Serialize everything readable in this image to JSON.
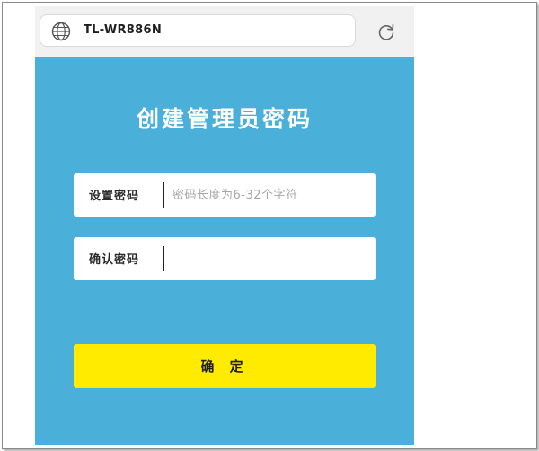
{
  "browser": {
    "url": "TL-WR886N",
    "icons": {
      "site": "globe-icon",
      "reload": "refresh-icon"
    }
  },
  "page": {
    "title": "创建管理员密码",
    "background_color": "#4aafd9"
  },
  "form": {
    "set_password": {
      "label": "设置密码",
      "value": "",
      "placeholder": "密码长度为6-32个字符"
    },
    "confirm_password": {
      "label": "确认密码",
      "value": "",
      "placeholder": ""
    },
    "submit": {
      "label": "确 定",
      "color": "#ffeb00"
    }
  }
}
